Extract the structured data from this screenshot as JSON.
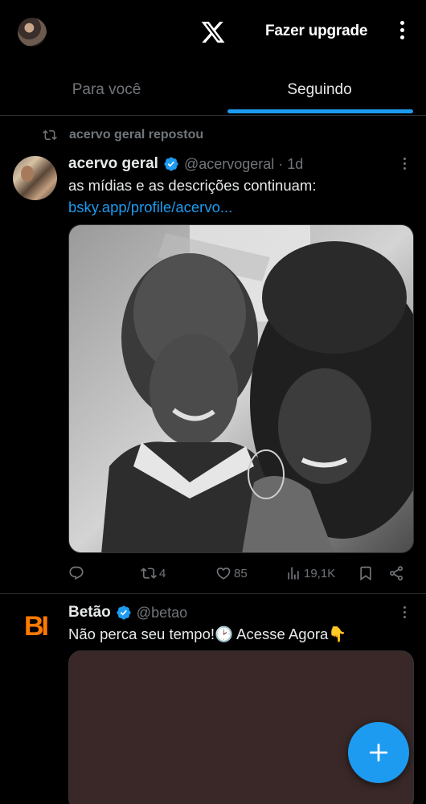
{
  "header": {
    "upgrade_label": "Fazer upgrade"
  },
  "tabs": [
    {
      "label": "Para você",
      "active": false
    },
    {
      "label": "Seguindo",
      "active": true
    }
  ],
  "posts": [
    {
      "repost_label": "acervo geral repostou",
      "author_name": "acervo geral",
      "handle": "@acervogeral",
      "separator": "·",
      "time": "1d",
      "text": "as mídias e as descrições continuam:",
      "link": "bsky.app/profile/acervo...",
      "replies": "",
      "reposts": "4",
      "likes": "85",
      "views": "19,1K"
    },
    {
      "author_name": "Betão",
      "handle": "@betao",
      "avatar_text": "BI",
      "text": "Não perca seu tempo!🕑 Acesse Agora👇"
    }
  ],
  "icons": {
    "x_logo": "x-logo-icon",
    "verified": "verified-badge-icon",
    "repost": "repost-icon",
    "reply": "reply-icon",
    "like": "heart-icon",
    "views": "views-icon",
    "bookmark": "bookmark-icon",
    "share": "share-icon",
    "compose": "plus-icon"
  },
  "colors": {
    "accent": "#1d9bf0",
    "background": "#000000",
    "text": "#e7e9ea",
    "muted": "#71767b",
    "brand_orange": "#ff7a00"
  }
}
